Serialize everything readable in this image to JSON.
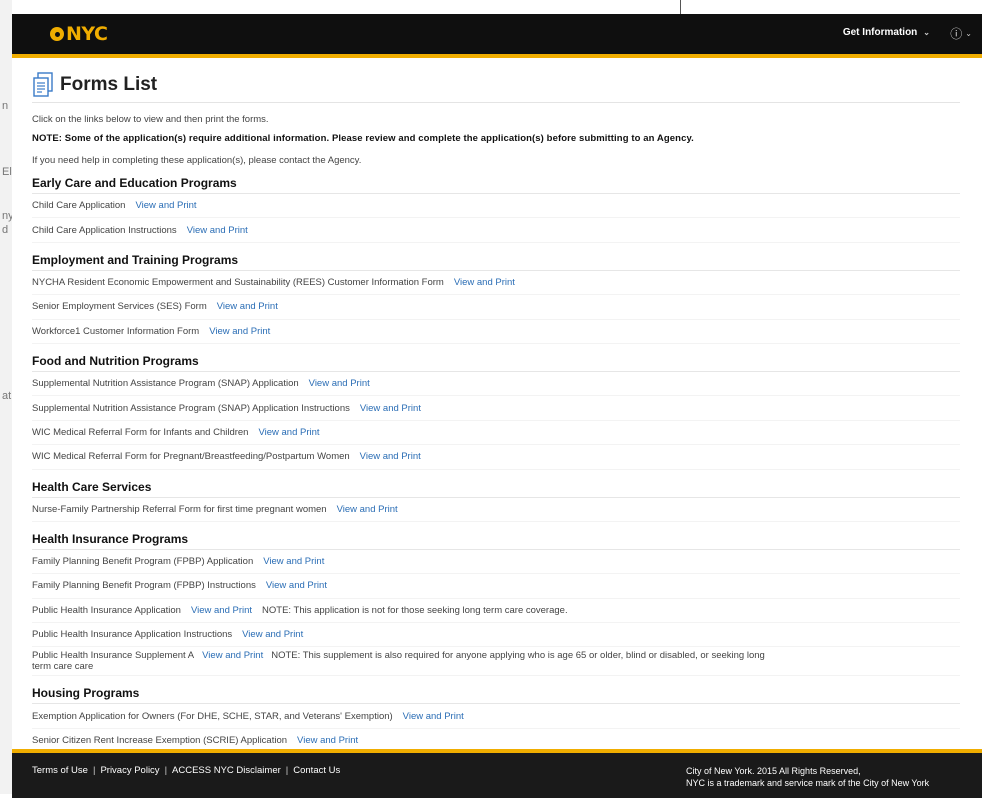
{
  "header": {
    "logo_text": "NYC",
    "get_info_label": "Get Information",
    "help_icon": "help-circle-icon"
  },
  "page": {
    "title": "Forms List",
    "intro1": "Click on the links below to view and then print the forms.",
    "note": "NOTE: Some of the application(s) require additional information. Please review and complete the application(s) before submitting to an Agency.",
    "intro2": "If you need help in completing these application(s), please contact the Agency."
  },
  "sections": [
    {
      "title": "Early Care and Education Programs",
      "forms": [
        {
          "name": "Child Care Application",
          "link": "View and Print"
        },
        {
          "name": "Child Care Application Instructions",
          "link": "View and Print"
        }
      ]
    },
    {
      "title": "Employment and Training Programs",
      "forms": [
        {
          "name": "NYCHA Resident Economic Empowerment and Sustainability (REES) Customer Information Form",
          "link": "View and Print"
        },
        {
          "name": "Senior Employment Services (SES) Form",
          "link": "View and Print"
        },
        {
          "name": "Workforce1 Customer Information Form",
          "link": "View and Print"
        }
      ]
    },
    {
      "title": "Food and Nutrition Programs",
      "forms": [
        {
          "name": "Supplemental Nutrition Assistance Program (SNAP) Application",
          "link": "View and Print"
        },
        {
          "name": "Supplemental Nutrition Assistance Program (SNAP) Application Instructions",
          "link": "View and Print"
        },
        {
          "name": "WIC Medical Referral Form for Infants and Children",
          "link": "View and Print"
        },
        {
          "name": "WIC Medical Referral Form for Pregnant/Breastfeeding/Postpartum Women",
          "link": "View and Print"
        }
      ]
    },
    {
      "title": "Health Care Services",
      "forms": [
        {
          "name": "Nurse-Family Partnership Referral Form for first time pregnant women",
          "link": "View and Print"
        }
      ]
    },
    {
      "title": "Health Insurance Programs",
      "forms": [
        {
          "name": "Family Planning Benefit Program (FPBP) Application",
          "link": "View and Print"
        },
        {
          "name": "Family Planning Benefit Program (FPBP) Instructions",
          "link": "View and Print"
        },
        {
          "name": "Public Health Insurance Application",
          "link": "View and Print",
          "note": "NOTE: This application is not for those seeking long term care coverage."
        },
        {
          "name": "Public Health Insurance Application Instructions",
          "link": "View and Print"
        },
        {
          "name": "Public Health Insurance Supplement A",
          "link": "View and Print",
          "note": "NOTE: This supplement is also required for anyone applying who is age 65 or older, blind or disabled, or seeking long term care care",
          "tall": true
        }
      ]
    },
    {
      "title": "Housing Programs",
      "forms": [
        {
          "name": "Exemption Application for Owners (For DHE, SCHE, STAR, and Veterans' Exemption)",
          "link": "View and Print"
        },
        {
          "name": "Senior Citizen Rent Increase Exemption (SCRIE) Application",
          "link": "View and Print"
        }
      ]
    }
  ],
  "footer": {
    "links": [
      "Terms of Use",
      "Privacy Policy",
      "ACCESS NYC Disclaimer",
      "Contact Us"
    ],
    "copyright_line1": "City of New York. 2015 All Rights Reserved,",
    "copyright_line2": "NYC is a trademark and service mark of the City of New York"
  },
  "background_fragments": [
    "n",
    "El",
    "ny",
    "d",
    "at"
  ],
  "colors": {
    "header_bg": "#0f0f0f",
    "accent": "#f0ad00",
    "link": "#2a6db5"
  }
}
